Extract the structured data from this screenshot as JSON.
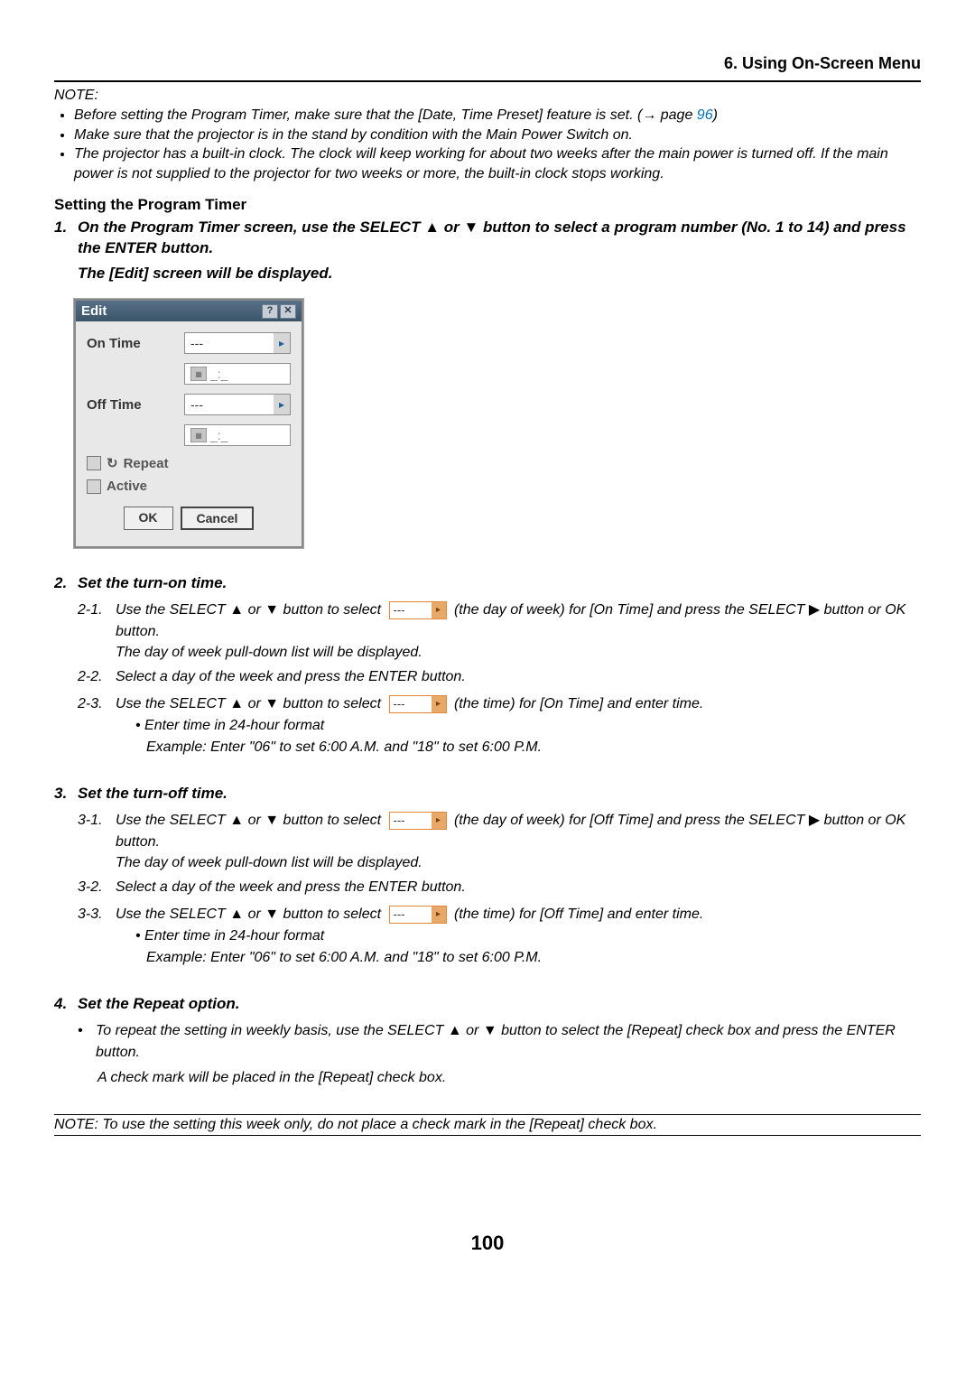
{
  "header": {
    "title": "6. Using On-Screen Menu"
  },
  "note": {
    "label": "NOTE:",
    "items": [
      "Before setting the Program Timer, make sure that the [Date, Time Preset] feature is set. (→ page ",
      "Make sure that the projector is in the stand by condition with the Main Power Switch on.",
      "The projector has a built-in clock. The clock will keep working for about two weeks after the main power is turned off. If the main power is not supplied to the projector for two weeks or more, the built-in clock stops working."
    ],
    "page_link": "96",
    "item1_tail": ")"
  },
  "section_title": "Setting the Program Timer",
  "step1": {
    "num": "1.",
    "text_a": "On the Program Timer screen, use the SELECT ",
    "text_b": " or ",
    "text_c": " button to select a program number (No. 1 to 14) and press the ENTER button.",
    "follow": "The [Edit] screen will be displayed."
  },
  "triangles": {
    "up": "▲",
    "down": "▼",
    "right": "▶",
    "small_right": "▸"
  },
  "dialog": {
    "title": "Edit",
    "help_icon": "?",
    "close_icon": "✕",
    "on_time_label": "On Time",
    "off_time_label": "Off Time",
    "dash": "---",
    "time_placeholder": "_:_",
    "repeat_label": "Repeat",
    "repeat_icon": "↻",
    "active_label": "Active",
    "ok": "OK",
    "cancel": "Cancel"
  },
  "step2": {
    "num": "2.",
    "title": "Set the turn-on time.",
    "s21_num": "2-1.",
    "s21_a": "Use the SELECT ",
    "s21_b": " or ",
    "s21_c": " button to select ",
    "s21_d": " (the day of week) for [On Time] and press the SELECT ",
    "s21_e": " button or OK button.",
    "s21_follow": "The day of week pull-down list will be displayed.",
    "s22_num": "2-2.",
    "s22": "Select a day of the week and press the ENTER button.",
    "s23_num": "2-3.",
    "s23_a": "Use the SELECT ",
    "s23_b": " or ",
    "s23_c": " button to select ",
    "s23_d": " (the time) for [On Time] and enter time.",
    "b1": "• Enter time in 24-hour format",
    "b2": "Example: Enter \"06\" to set 6:00 A.M. and \"18\" to set 6:00 P.M."
  },
  "step3": {
    "num": "3.",
    "title": "Set the turn-off time.",
    "s31_num": "3-1.",
    "s31_a": "Use the SELECT ",
    "s31_b": " or ",
    "s31_c": " button to select ",
    "s31_d": " (the day of week) for [Off Time] and press the SELECT ",
    "s31_e": " button or OK button.",
    "s31_follow": "The day of week pull-down list will be displayed.",
    "s32_num": "3-2.",
    "s32": "Select a day of the week and press the ENTER button.",
    "s33_num": "3-3.",
    "s33_a": "Use the SELECT ",
    "s33_b": " or ",
    "s33_c": " button to select ",
    "s33_d": " (the time) for [Off Time] and enter time.",
    "b1": "• Enter time in 24-hour format",
    "b2": "Example: Enter \"06\" to set 6:00 A.M. and \"18\" to set 6:00 P.M."
  },
  "step4": {
    "num": "4.",
    "title": "Set the Repeat option.",
    "bul_a": "To repeat the setting in weekly basis, use the SELECT ",
    "bul_b": " or ",
    "bul_c": " button to select the [Repeat] check box and press the ENTER button.",
    "follow": "A check mark will be placed in the [Repeat] check box."
  },
  "bottom_note": "NOTE: To use the setting this week only, do not place a check mark in the [Repeat] check box.",
  "page_number": "100",
  "inline_field_text": "---"
}
